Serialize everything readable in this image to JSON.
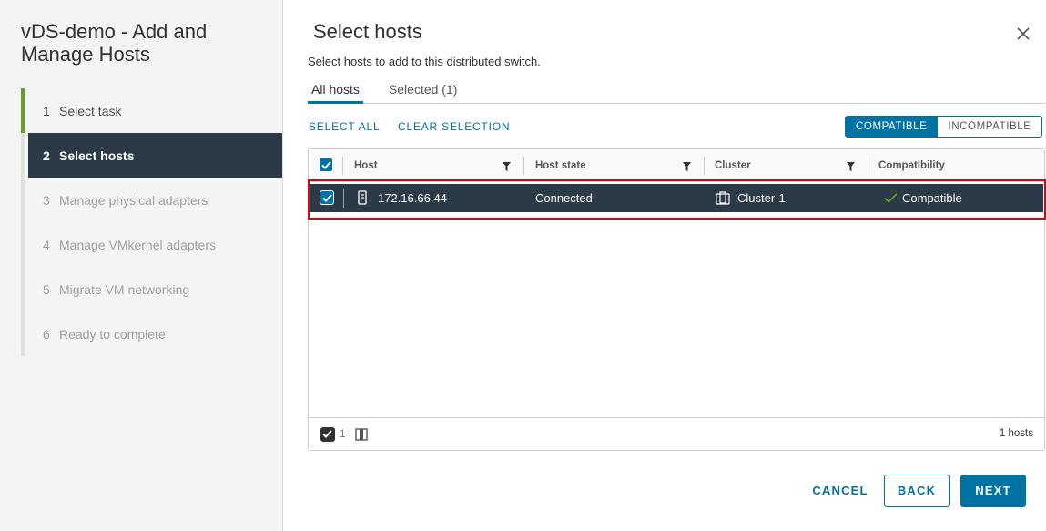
{
  "wizard": {
    "title_line1": "vDS-demo - Add and",
    "title_line2": "Manage Hosts",
    "steps": [
      {
        "num": "1",
        "label": "Select task"
      },
      {
        "num": "2",
        "label": "Select hosts"
      },
      {
        "num": "3",
        "label": "Manage physical adapters"
      },
      {
        "num": "4",
        "label": "Manage VMkernel adapters"
      },
      {
        "num": "5",
        "label": "Migrate VM networking"
      },
      {
        "num": "6",
        "label": "Ready to complete"
      }
    ]
  },
  "page": {
    "title": "Select hosts",
    "subtitle": "Select hosts to add to this distributed switch."
  },
  "tabs": [
    {
      "label": "All hosts"
    },
    {
      "label": "Selected (1)"
    }
  ],
  "actions": {
    "select_all": "SELECT ALL",
    "clear_selection": "CLEAR SELECTION"
  },
  "filter_toggle": {
    "compatible": "COMPATIBLE",
    "incompatible": "INCOMPATIBLE"
  },
  "grid": {
    "columns": [
      "Host",
      "Host state",
      "Cluster",
      "Compatibility"
    ],
    "rows": [
      {
        "host": "172.16.66.44",
        "state": "Connected",
        "cluster": "Cluster-1",
        "compatibility": "Compatible",
        "selected": true
      }
    ],
    "footer": {
      "selected_count": "1",
      "total": "1 hosts"
    }
  },
  "buttons": {
    "cancel": "CANCEL",
    "back": "BACK",
    "next": "NEXT"
  },
  "colors": {
    "accent": "#0072a3",
    "selected_row": "#2b3a46",
    "step_done": "#62a420",
    "highlight": "#e3000f"
  }
}
